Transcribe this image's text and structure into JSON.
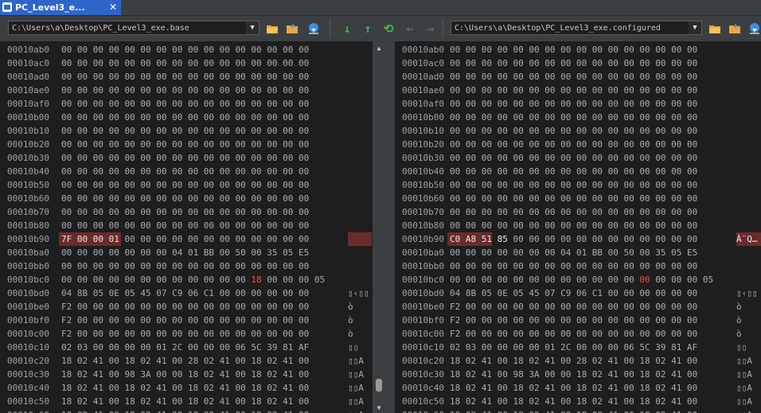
{
  "tab": {
    "title": "PC_Level3_e...",
    "close": "✕"
  },
  "left": {
    "path": "C:\\Users\\a\\Desktop\\PC_Level3_exe.base"
  },
  "right": {
    "path": "C:\\Users\\a\\Desktop\\PC_Level3_exe.configured"
  },
  "icons": {
    "folder": "📁",
    "reload": "⟳",
    "down": "↓",
    "up": "↑",
    "sync": "⟲",
    "back": "←",
    "fwd": "→",
    "dropdown": "▼"
  },
  "rows": [
    {
      "addr": "00010ab0",
      "l": "00 00 00 00 00 00 00 00 00 00 00 00 00 00 00 00",
      "r": "00 00 00 00 00 00 00 00 00 00 00 00 00 00 00 00",
      "la": "",
      "ra": ""
    },
    {
      "addr": "00010ac0",
      "l": "00 00 00 00 00 00 00 00 00 00 00 00 00 00 00 00",
      "r": "00 00 00 00 00 00 00 00 00 00 00 00 00 00 00 00",
      "la": "",
      "ra": ""
    },
    {
      "addr": "00010ad0",
      "l": "00 00 00 00 00 00 00 00 00 00 00 00 00 00 00 00",
      "r": "00 00 00 00 00 00 00 00 00 00 00 00 00 00 00 00",
      "la": "",
      "ra": ""
    },
    {
      "addr": "00010ae0",
      "l": "00 00 00 00 00 00 00 00 00 00 00 00 00 00 00 00",
      "r": "00 00 00 00 00 00 00 00 00 00 00 00 00 00 00 00",
      "la": "",
      "ra": ""
    },
    {
      "addr": "00010af0",
      "l": "00 00 00 00 00 00 00 00 00 00 00 00 00 00 00 00",
      "r": "00 00 00 00 00 00 00 00 00 00 00 00 00 00 00 00",
      "la": "",
      "ra": ""
    },
    {
      "addr": "00010b00",
      "l": "00 00 00 00 00 00 00 00 00 00 00 00 00 00 00 00",
      "r": "00 00 00 00 00 00 00 00 00 00 00 00 00 00 00 00",
      "la": "",
      "ra": ""
    },
    {
      "addr": "00010b10",
      "l": "00 00 00 00 00 00 00 00 00 00 00 00 00 00 00 00",
      "r": "00 00 00 00 00 00 00 00 00 00 00 00 00 00 00 00",
      "la": "",
      "ra": ""
    },
    {
      "addr": "00010b20",
      "l": "00 00 00 00 00 00 00 00 00 00 00 00 00 00 00 00",
      "r": "00 00 00 00 00 00 00 00 00 00 00 00 00 00 00 00",
      "la": "",
      "ra": ""
    },
    {
      "addr": "00010b30",
      "l": "00 00 00 00 00 00 00 00 00 00 00 00 00 00 00 00",
      "r": "00 00 00 00 00 00 00 00 00 00 00 00 00 00 00 00",
      "la": "",
      "ra": ""
    },
    {
      "addr": "00010b40",
      "l": "00 00 00 00 00 00 00 00 00 00 00 00 00 00 00 00",
      "r": "00 00 00 00 00 00 00 00 00 00 00 00 00 00 00 00",
      "la": "",
      "ra": ""
    },
    {
      "addr": "00010b50",
      "l": "00 00 00 00 00 00 00 00 00 00 00 00 00 00 00 00",
      "r": "00 00 00 00 00 00 00 00 00 00 00 00 00 00 00 00",
      "la": "",
      "ra": ""
    },
    {
      "addr": "00010b60",
      "l": "00 00 00 00 00 00 00 00 00 00 00 00 00 00 00 00",
      "r": "00 00 00 00 00 00 00 00 00 00 00 00 00 00 00 00",
      "la": "",
      "ra": ""
    },
    {
      "addr": "00010b70",
      "l": "00 00 00 00 00 00 00 00 00 00 00 00 00 00 00 00",
      "r": "00 00 00 00 00 00 00 00 00 00 00 00 00 00 00 00",
      "la": "",
      "ra": ""
    },
    {
      "addr": "00010b80",
      "l": "00 00 00 00 00 00 00 00 00 00 00 00 00 00 00 00",
      "r": "00 00 00 00 00 00 00 00 00 00 00 00 00 00 00 00",
      "la": "",
      "ra": ""
    },
    {
      "addr": "00010b90",
      "l": "7F 00 00 01 00 00 00 00 00 00 00 00 00 00 00 00",
      "r": "C0 A8 51 85 00 00 00 00 00 00 00 00 00 00 00 00",
      "la": "  \u0001",
      "ra": "À¨Q…",
      "diff": true,
      "lchg": "7F 00 00 01",
      "rchg": "C0 A8 51 85",
      "lrest": " 00 00 00 00 00 00 00 00 00 00 00 00",
      "rrest": " 00 00 00 00 00 00 00 00 00 00 00 00"
    },
    {
      "addr": "00010ba0",
      "l": "00 00 00 00 00 00 00 04 01 BB 00 50 00 35 05 E5",
      "r": "00 00 00 00 00 00 00 04 01 BB 00 50 00 35 05 E5",
      "la": "",
      "ra": ""
    },
    {
      "addr": "00010bb0",
      "l": "00 00 00 00 00 00 00 00 00 00 00 00 00 00 00 00",
      "r": "00 00 00 00 00 00 00 00 00 00 00 00 00 00 00 00",
      "la": "",
      "ra": ""
    },
    {
      "addr": "00010bc0",
      "l": "00 00 00 00 00 00 00 00 00 00 00 00 00 00 00 05",
      "r": "00 00 00 00 00 00 00 00 00 00 00 00 00 00 00 05",
      "la": "",
      "ra": "",
      "red": true,
      "lpre": "00 00 00 00 00 00 00 00 00 00 00 00 ",
      "lred": "18",
      "lpost": " 00 00 00 05",
      "rpre": "00 00 00 00 00 00 00 00 00 00 00 00 ",
      "rred": "00",
      "rpost": " 00 00 00 05"
    },
    {
      "addr": "00010bd0",
      "l": "04 8B 05 0E 05 45 07 C9 06 C1 00 00 00 00 00 00",
      "r": "04 8B 05 0E 05 45 07 C9 06 C1 00 00 00 00 00 00",
      "la": "▯‹▯▯",
      "ra": "▯‹▯▯"
    },
    {
      "addr": "00010be0",
      "l": "F2 00 00 00 00 00 00 00 00 00 00 00 00 00 00 00",
      "r": "F2 00 00 00 00 00 00 00 00 00 00 00 00 00 00 00",
      "la": "ò",
      "ra": "ò"
    },
    {
      "addr": "00010bf0",
      "l": "F2 00 00 00 00 00 00 00 00 00 00 00 00 00 00 00",
      "r": "F2 00 00 00 00 00 00 00 00 00 00 00 00 00 00 00",
      "la": "ò",
      "ra": "ò"
    },
    {
      "addr": "00010c00",
      "l": "F2 00 00 00 00 00 00 00 00 00 00 00 00 00 00 00",
      "r": "F2 00 00 00 00 00 00 00 00 00 00 00 00 00 00 00",
      "la": "ò",
      "ra": "ò"
    },
    {
      "addr": "00010c10",
      "l": "02 03 00 00 00 00 01 2C 00 00 00 06 5C 39 81 AF",
      "r": "02 03 00 00 00 00 01 2C 00 00 00 06 5C 39 81 AF",
      "la": "▯▯",
      "ra": "▯▯"
    },
    {
      "addr": "00010c20",
      "l": "18 02 41 00 18 02 41 00 28 02 41 00 18 02 41 00",
      "r": "18 02 41 00 18 02 41 00 28 02 41 00 18 02 41 00",
      "la": "▯▯A",
      "ra": "▯▯A"
    },
    {
      "addr": "00010c30",
      "l": "18 02 41 00 98 3A 00 00 18 02 41 00 18 02 41 00",
      "r": "18 02 41 00 98 3A 00 00 18 02 41 00 18 02 41 00",
      "la": "▯▯A",
      "ra": "▯▯A"
    },
    {
      "addr": "00010c40",
      "l": "18 02 41 00 18 02 41 00 18 02 41 00 18 02 41 00",
      "r": "18 02 41 00 18 02 41 00 18 02 41 00 18 02 41 00",
      "la": "▯▯A",
      "ra": "▯▯A"
    },
    {
      "addr": "00010c50",
      "l": "18 02 41 00 18 02 41 00 18 02 41 00 18 02 41 00",
      "r": "18 02 41 00 18 02 41 00 18 02 41 00 18 02 41 00",
      "la": "▯▯A",
      "ra": "▯▯A"
    },
    {
      "addr": "00010c60",
      "l": "18 02 41 00 18 02 41 00 18 02 41 00 18 02 41 00",
      "r": "18 02 41 00 18 02 41 00 18 02 41 00 18 02 41 00",
      "la": "▯▯A",
      "ra": "▯▯A"
    }
  ]
}
